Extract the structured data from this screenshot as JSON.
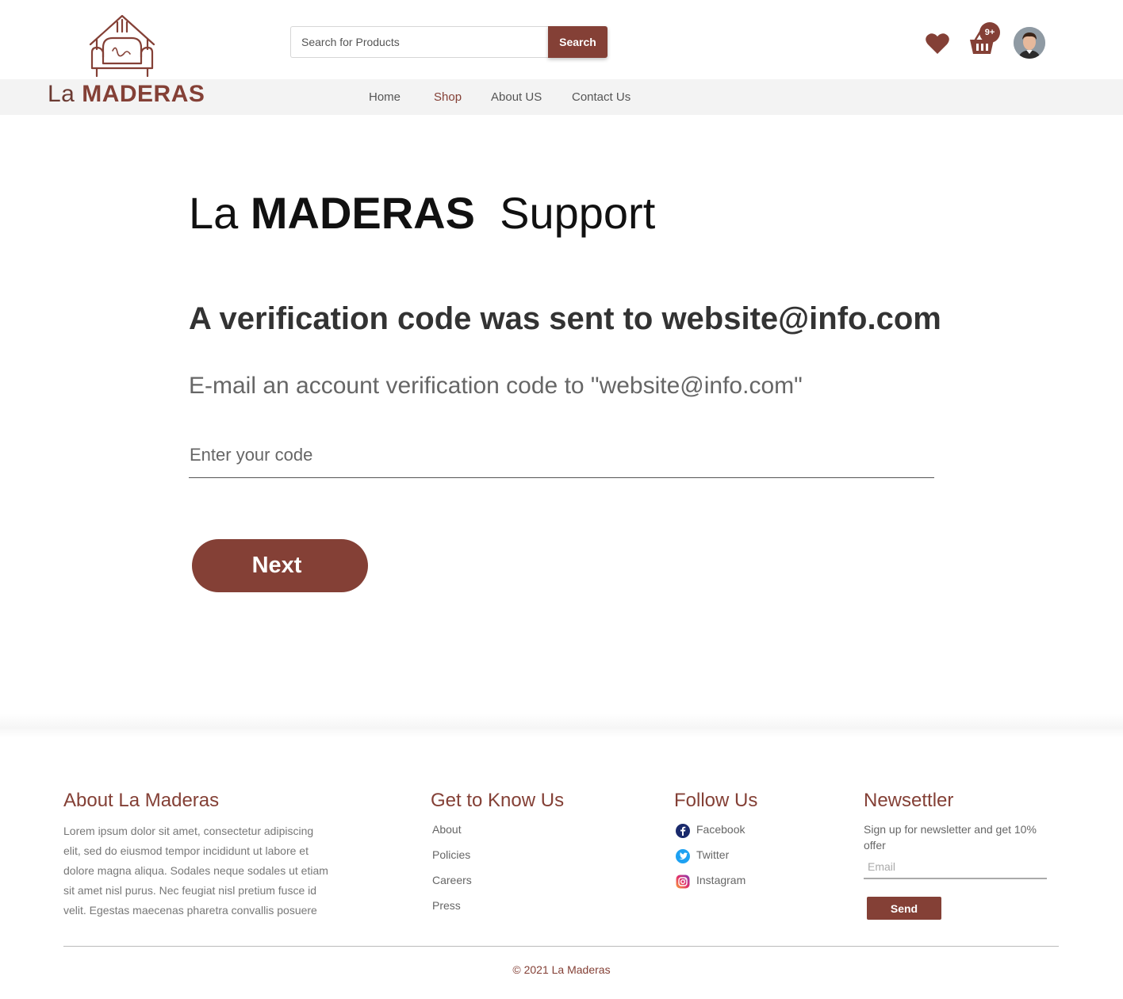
{
  "brand": {
    "logo_la": "La",
    "logo_maderas": "MADERAS",
    "accent_color": "#844036"
  },
  "header": {
    "search_placeholder": "Search for Products",
    "search_button": "Search",
    "cart_badge": "9+",
    "icons": [
      "heart-icon",
      "basket-icon",
      "avatar"
    ]
  },
  "nav": {
    "items": [
      {
        "label": "Home",
        "active": false
      },
      {
        "label": "Shop",
        "active": true
      },
      {
        "label": "About US",
        "active": false
      },
      {
        "label": "Contact Us",
        "active": false
      }
    ]
  },
  "main": {
    "title_la": "La",
    "title_brand": "MADERAS",
    "title_support": "Support",
    "heading": "A verification code was sent to website@info.com",
    "subtext": "E-mail an account verification code to \"website@info.com\"",
    "code_placeholder": "Enter your code",
    "next_button": "Next"
  },
  "footer": {
    "about": {
      "heading": "About La Maderas",
      "text": "Lorem ipsum dolor sit amet, consectetur adipiscing elit, sed do eiusmod tempor incididunt ut labore et dolore magna aliqua. Sodales neque sodales ut etiam sit amet nisl purus. Nec feugiat nisl pretium fusce id velit. Egestas maecenas pharetra convallis posuere"
    },
    "know": {
      "heading": "Get to Know Us",
      "links": [
        "About",
        "Policies",
        "Careers",
        "Press"
      ]
    },
    "follow": {
      "heading": "Follow Us",
      "links": [
        "Facebook",
        "Twitter",
        "Instagram"
      ]
    },
    "newsletter": {
      "heading": "Newsettler",
      "text": "Sign up for newsletter and get 10% offer",
      "email_placeholder": "Email",
      "send_button": "Send"
    },
    "copyright": "© 2021 La Maderas"
  }
}
